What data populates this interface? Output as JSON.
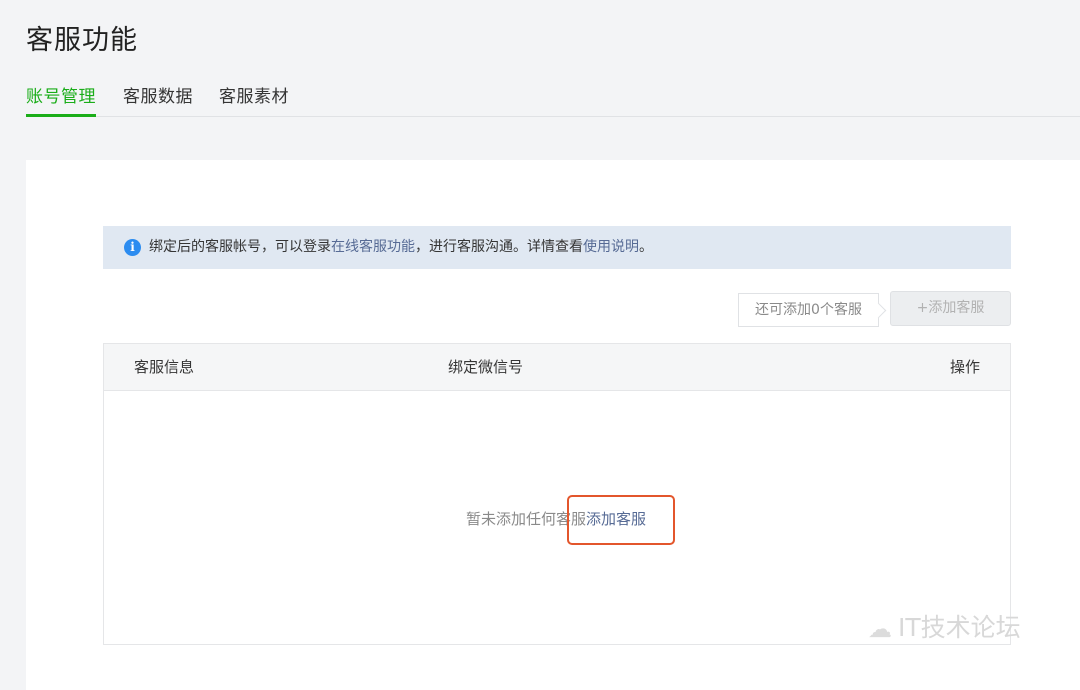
{
  "page": {
    "title": "客服功能"
  },
  "tabs": [
    {
      "label": "账号管理",
      "active": true
    },
    {
      "label": "客服数据",
      "active": false
    },
    {
      "label": "客服素材",
      "active": false
    }
  ],
  "notice": {
    "icon": "info-icon",
    "text_before": "绑定后的客服帐号，可以登录",
    "link1": "在线客服功能",
    "text_middle": "，进行客服沟通。详情查看",
    "link2": "使用说明",
    "text_after": "。"
  },
  "toolbar": {
    "quota_tip": "还可添加0个客服",
    "add_button": "+添加客服"
  },
  "table": {
    "columns": [
      "客服信息",
      "绑定微信号",
      "操作"
    ],
    "empty_text": "暂未添加任何客服",
    "empty_link": "添加客服"
  },
  "watermark": {
    "icon": "wechat-icon",
    "text": "IT技术论坛"
  },
  "colors": {
    "accent": "#1aad19",
    "link": "#576b95",
    "notice_bg": "#e0e8f2",
    "highlight": "#e3562c"
  }
}
